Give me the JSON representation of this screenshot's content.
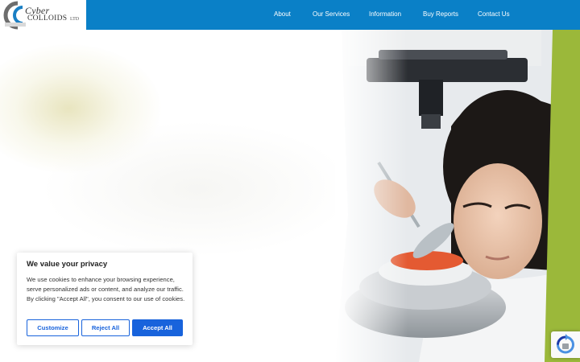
{
  "brand": {
    "logo_line1": "Cyber",
    "logo_line2": "COLLOIDS",
    "logo_suffix": "LTD"
  },
  "nav": {
    "items": [
      "About",
      "Our Services",
      "Information",
      "Buy Reports",
      "Contact Us"
    ]
  },
  "cookie_banner": {
    "title": "We value your privacy",
    "body": "We use cookies to enhance your browsing experience, serve personalized ads or content, and analyze our traffic. By clicking \"Accept All\", you consent to our use of cookies.",
    "customize_label": "Customize",
    "reject_label": "Reject All",
    "accept_label": "Accept All"
  },
  "colors": {
    "header": "#0a80c7",
    "accent_green": "#9bb83a",
    "cookie_button": "#1863dc"
  },
  "icons": {
    "recaptcha": "recaptcha-badge-icon"
  }
}
